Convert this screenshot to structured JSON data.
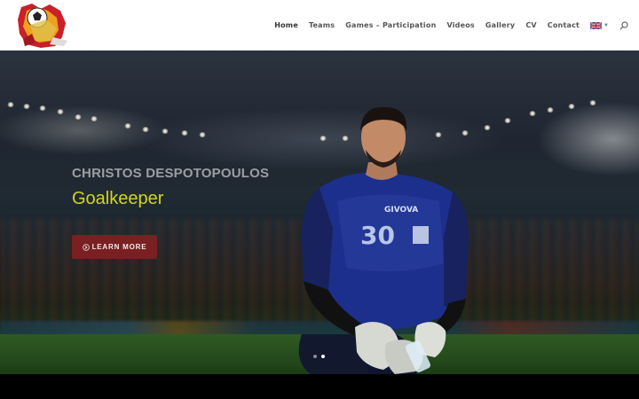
{
  "header": {
    "nav": [
      {
        "label": "Home",
        "active": true
      },
      {
        "label": "Teams",
        "active": false
      },
      {
        "label": "Games – Participation",
        "active": false
      },
      {
        "label": "Videos",
        "active": false
      },
      {
        "label": "Gallery",
        "active": false
      },
      {
        "label": "CV",
        "active": false
      },
      {
        "label": "Contact",
        "active": false
      }
    ],
    "language_icon": "uk-flag-icon",
    "search_icon": "search-icon"
  },
  "hero": {
    "subtitle": "CHRISTOS DESPOTOPOULOS",
    "title": "Goalkeeper",
    "cta_label": "LEARN MORE",
    "cta_icon": "arrow-circle-icon",
    "cta_color": "#7a1f22",
    "title_color": "#d4d41c",
    "jersey_number": "30",
    "jersey_brand": "GIVOVA",
    "slides": 2,
    "active_slide": 2
  }
}
